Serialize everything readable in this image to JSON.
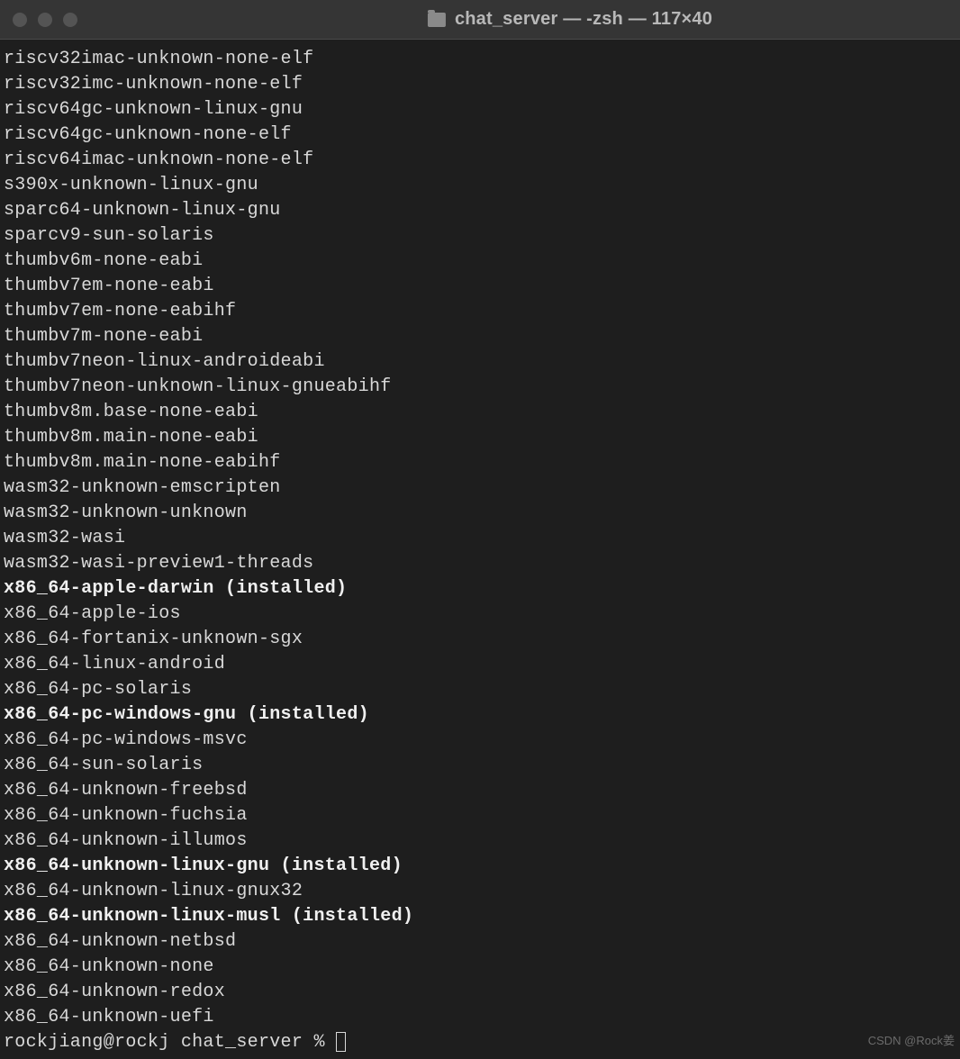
{
  "window": {
    "title": "chat_server — -zsh — 117×40"
  },
  "terminal": {
    "lines": [
      {
        "text": "riscv32imac-unknown-none-elf",
        "bold": false
      },
      {
        "text": "riscv32imc-unknown-none-elf",
        "bold": false
      },
      {
        "text": "riscv64gc-unknown-linux-gnu",
        "bold": false
      },
      {
        "text": "riscv64gc-unknown-none-elf",
        "bold": false
      },
      {
        "text": "riscv64imac-unknown-none-elf",
        "bold": false
      },
      {
        "text": "s390x-unknown-linux-gnu",
        "bold": false
      },
      {
        "text": "sparc64-unknown-linux-gnu",
        "bold": false
      },
      {
        "text": "sparcv9-sun-solaris",
        "bold": false
      },
      {
        "text": "thumbv6m-none-eabi",
        "bold": false
      },
      {
        "text": "thumbv7em-none-eabi",
        "bold": false
      },
      {
        "text": "thumbv7em-none-eabihf",
        "bold": false
      },
      {
        "text": "thumbv7m-none-eabi",
        "bold": false
      },
      {
        "text": "thumbv7neon-linux-androideabi",
        "bold": false
      },
      {
        "text": "thumbv7neon-unknown-linux-gnueabihf",
        "bold": false
      },
      {
        "text": "thumbv8m.base-none-eabi",
        "bold": false
      },
      {
        "text": "thumbv8m.main-none-eabi",
        "bold": false
      },
      {
        "text": "thumbv8m.main-none-eabihf",
        "bold": false
      },
      {
        "text": "wasm32-unknown-emscripten",
        "bold": false
      },
      {
        "text": "wasm32-unknown-unknown",
        "bold": false
      },
      {
        "text": "wasm32-wasi",
        "bold": false
      },
      {
        "text": "wasm32-wasi-preview1-threads",
        "bold": false
      },
      {
        "text": "x86_64-apple-darwin (installed)",
        "bold": true
      },
      {
        "text": "x86_64-apple-ios",
        "bold": false
      },
      {
        "text": "x86_64-fortanix-unknown-sgx",
        "bold": false
      },
      {
        "text": "x86_64-linux-android",
        "bold": false
      },
      {
        "text": "x86_64-pc-solaris",
        "bold": false
      },
      {
        "text": "x86_64-pc-windows-gnu (installed)",
        "bold": true
      },
      {
        "text": "x86_64-pc-windows-msvc",
        "bold": false
      },
      {
        "text": "x86_64-sun-solaris",
        "bold": false
      },
      {
        "text": "x86_64-unknown-freebsd",
        "bold": false
      },
      {
        "text": "x86_64-unknown-fuchsia",
        "bold": false
      },
      {
        "text": "x86_64-unknown-illumos",
        "bold": false
      },
      {
        "text": "x86_64-unknown-linux-gnu (installed)",
        "bold": true
      },
      {
        "text": "x86_64-unknown-linux-gnux32",
        "bold": false
      },
      {
        "text": "x86_64-unknown-linux-musl (installed)",
        "bold": true
      },
      {
        "text": "x86_64-unknown-netbsd",
        "bold": false
      },
      {
        "text": "x86_64-unknown-none",
        "bold": false
      },
      {
        "text": "x86_64-unknown-redox",
        "bold": false
      },
      {
        "text": "x86_64-unknown-uefi",
        "bold": false
      }
    ],
    "prompt": "rockjiang@rockj chat_server % "
  },
  "watermark": "CSDN @Rock姜"
}
